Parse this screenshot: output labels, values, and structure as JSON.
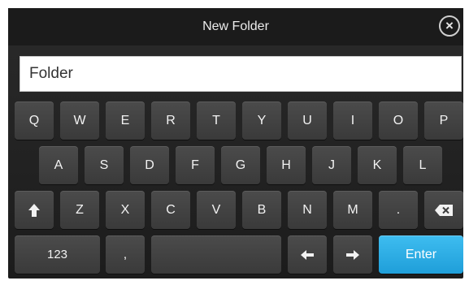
{
  "dialog": {
    "title": "New Folder",
    "close_icon": "close-circle-icon"
  },
  "input": {
    "value": "Folder"
  },
  "keyboard": {
    "row1": [
      "Q",
      "W",
      "E",
      "R",
      "T",
      "Y",
      "U",
      "I",
      "O",
      "P"
    ],
    "row2": [
      "A",
      "S",
      "D",
      "F",
      "G",
      "H",
      "J",
      "K",
      "L"
    ],
    "row3": [
      "Z",
      "X",
      "C",
      "V",
      "B",
      "N",
      "M",
      "."
    ],
    "shift_icon": "shift-arrow-icon",
    "backspace_icon": "backspace-icon",
    "numbers_label": "123",
    "comma_label": ",",
    "left_icon": "arrow-left-icon",
    "right_icon": "arrow-right-icon",
    "enter_label": "Enter"
  },
  "colors": {
    "enter_accent": "#2aa9e0",
    "panel_background": "#222222"
  }
}
